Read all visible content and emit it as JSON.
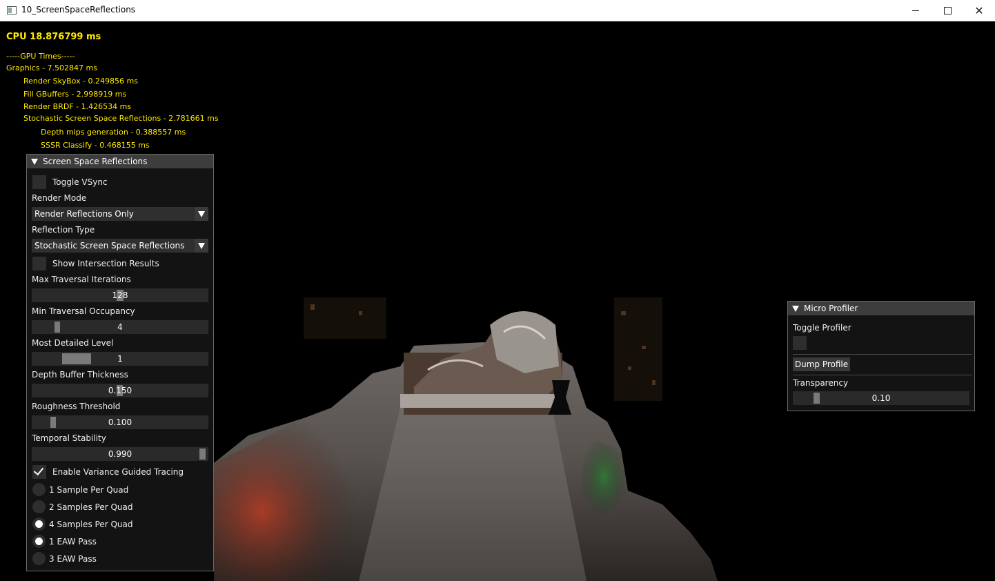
{
  "window": {
    "title": "10_ScreenSpaceReflections"
  },
  "stats": {
    "cpu": "CPU 18.876799 ms",
    "gpu_lines": [
      "-----GPU Times-----",
      "Graphics - 7.502847 ms",
      "Render SkyBox - 0.249856 ms",
      "Fill GBuffers - 2.998919 ms",
      "Render BRDF - 1.426534 ms",
      "Stochastic Screen Space Reflections - 2.781661 ms",
      "Depth mips generation - 0.388557 ms",
      "SSSR Classify - 0.468155 ms"
    ]
  },
  "ssr_panel": {
    "title": "Screen Space Reflections",
    "toggle_vsync": {
      "label": "Toggle VSync",
      "checked": false
    },
    "render_mode": {
      "label": "Render Mode",
      "value": "Render Reflections Only"
    },
    "reflection_type": {
      "label": "Reflection Type",
      "value": "Stochastic Screen Space Reflections"
    },
    "show_intersection": {
      "label": "Show Intersection Results",
      "checked": false
    },
    "sliders": [
      {
        "label": "Max Traversal Iterations",
        "value": "128",
        "fraction": 0.5
      },
      {
        "label": "Min Traversal Occupancy",
        "value": "4",
        "fraction": 0.15
      },
      {
        "label": "Most Detailed Level",
        "value": "1",
        "fraction": 0.25
      },
      {
        "label": "Depth Buffer Thickness",
        "value": "0.150",
        "fraction": 0.5
      },
      {
        "label": "Roughness Threshold",
        "value": "0.100",
        "fraction": 0.1
      },
      {
        "label": "Temporal Stability",
        "value": "0.990",
        "fraction": 0.99
      }
    ],
    "variance_guided": {
      "label": "Enable Variance Guided Tracing",
      "checked": true
    },
    "radios": [
      {
        "label": "1 Sample  Per Quad",
        "selected": false
      },
      {
        "label": "2 Samples Per Quad",
        "selected": false
      },
      {
        "label": "4 Samples Per Quad",
        "selected": true
      },
      {
        "label": "1 EAW Pass",
        "selected": true
      },
      {
        "label": "3 EAW Pass",
        "selected": false
      }
    ]
  },
  "profiler_panel": {
    "title": "Micro Profiler",
    "toggle_label": "Toggle Profiler",
    "toggle_checked": false,
    "dump_label": "Dump Profile",
    "transparency_label": "Transparency",
    "transparency_value": "0.10",
    "transparency_fraction": 0.1
  },
  "colors": {
    "stats_text": "#ffea00",
    "panel_bg": "#141414",
    "panel_header": "#3d3d3d"
  }
}
